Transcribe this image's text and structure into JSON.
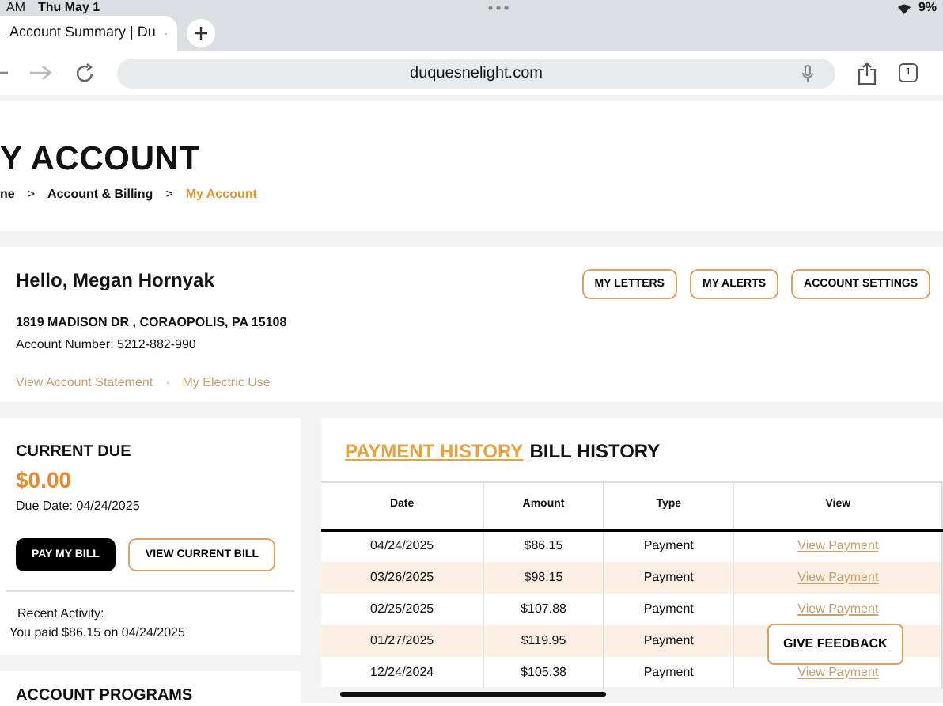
{
  "status_bar": {
    "time": "AM",
    "date": "Thu May 1",
    "battery": "9%"
  },
  "browser": {
    "tab_title": "Account Summary | Du",
    "url": "duquesnelight.com",
    "tab_count": "1"
  },
  "page": {
    "title": "Y ACCOUNT",
    "separator": ">",
    "breadcrumb": [
      {
        "label": "ne",
        "selected": false
      },
      {
        "label": "Account & Billing",
        "selected": false
      },
      {
        "label": "My Account",
        "selected": true
      }
    ]
  },
  "account": {
    "greeting": "Hello, Megan Hornyak",
    "address": "1819 MADISON DR , CORAOPOLIS, PA 15108",
    "account_number": "Account Number: 5212-882-990",
    "links_separator": "·",
    "links": [
      "View Account Statement",
      "My Electric Use"
    ],
    "buttons": [
      "MY LETTERS",
      "MY ALERTS",
      "ACCOUNT SETTINGS"
    ]
  },
  "current_due": {
    "heading": "CURRENT DUE",
    "amount": "$0.00",
    "due_date": "Due Date: 04/24/2025",
    "buttons": [
      {
        "label": "PAY MY BILL",
        "kind": "primary"
      },
      {
        "label": "VIEW CURRENT BILL",
        "kind": "outline"
      }
    ],
    "recent_label": "Recent Activity:",
    "recent_text": "You paid $86.15 on 04/24/2025"
  },
  "account_programs": {
    "heading": "ACCOUNT PROGRAMS"
  },
  "history": {
    "tabs": [
      {
        "label": "PAYMENT HISTORY",
        "selected": true
      },
      {
        "label": "BILL HISTORY",
        "selected": false
      }
    ],
    "columns": [
      "Date",
      "Amount",
      "Type",
      "View"
    ],
    "rows": [
      {
        "date": "04/24/2025",
        "amount": "$86.15",
        "type": "Payment",
        "view": "View Payment"
      },
      {
        "date": "03/26/2025",
        "amount": "$98.15",
        "type": "Payment",
        "view": "View Payment"
      },
      {
        "date": "02/25/2025",
        "amount": "$107.88",
        "type": "Payment",
        "view": "View Payment"
      },
      {
        "date": "01/27/2025",
        "amount": "$119.95",
        "type": "Payment"
      },
      {
        "date": "12/24/2024",
        "amount": "$105.38",
        "type": "Payment",
        "view": "View Payment"
      }
    ]
  },
  "feedback_button": "GIVE FEEDBACK"
}
